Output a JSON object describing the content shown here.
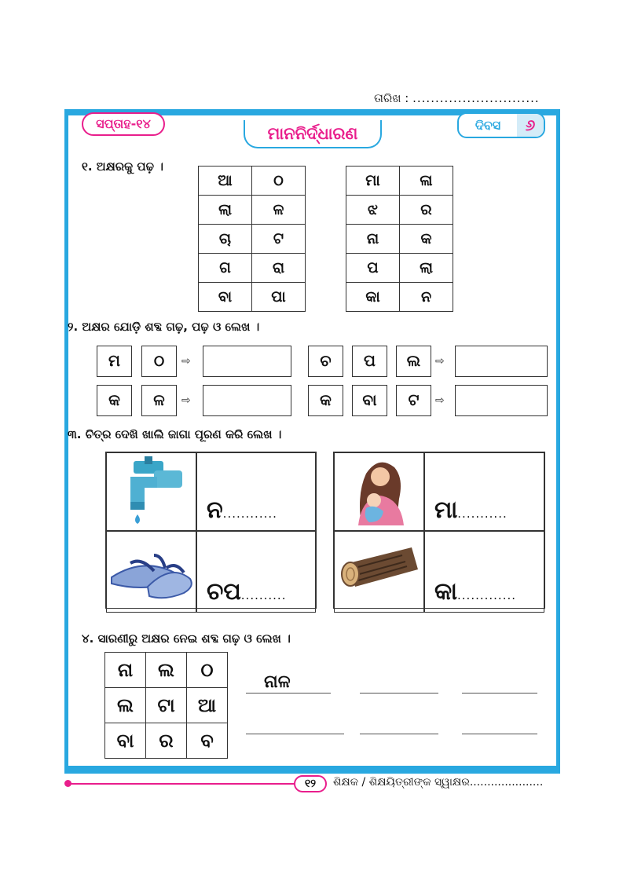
{
  "date_label": "ତାରିଖ :",
  "date_dots": "............................",
  "week_badge": "ସପ୍ତାହ-୧୪",
  "title": "ମାନନିର୍ଦ୍ଧାରଣ",
  "day_label": "ଦିବସ",
  "day_number": "୬",
  "q1": {
    "text": "୧. ଅକ୍ଷରକୁ ପଢ଼ ।",
    "table_left": [
      [
        "ଆ",
        "ଠ"
      ],
      [
        "ଲା",
        "ଳ"
      ],
      [
        "ଚା",
        "ଟ"
      ],
      [
        "ଗ",
        "ରା"
      ],
      [
        "ବା",
        "ପା"
      ]
    ],
    "table_right": [
      [
        "ମା",
        "ଳା"
      ],
      [
        "ଝ",
        "ର"
      ],
      [
        "ନା",
        "କ"
      ],
      [
        "ପ",
        "ଲା"
      ],
      [
        "କା",
        "ନ"
      ]
    ]
  },
  "q2": {
    "text": "୨. ଅକ୍ଷର ଯୋଡ଼ି ଶବ୍ଦ ଗଢ଼, ପଢ଼ ଓ ଲେଖ ।",
    "row1_left": [
      "ମ",
      "ଠ"
    ],
    "row1_right": [
      "ଚ",
      "ପ",
      "ଲ"
    ],
    "row2_left": [
      "କ",
      "ଳ"
    ],
    "row2_right": [
      "କ",
      "ବା",
      "ଟ"
    ],
    "arrow": "⇨"
  },
  "q3": {
    "text": "୩. ଚିତ୍ର ଦେଖି ଖାଲି ଜାଗା ପୂରଣ କରି ଲେଖ ।",
    "items": [
      {
        "picture": "tap-icon",
        "word": "ନ",
        "dots": "............"
      },
      {
        "picture": "slipper-icon",
        "word": "ଚପ",
        "dots": ".........."
      },
      {
        "picture": "mother-child-icon",
        "word": "ମା",
        "dots": "..........."
      },
      {
        "picture": "log-icon",
        "word": "କା",
        "dots": "............."
      }
    ]
  },
  "q4": {
    "text": "୪. ସାରଣୀରୁ ଅକ୍ଷର ନେଇ ଶବ୍ଦ ଗଢ଼ ଓ ଲେଖ ।",
    "grid": [
      [
        "ନା",
        "ଲ",
        "ଠ"
      ],
      [
        "ଲ",
        "ଟା",
        "ଆ"
      ],
      [
        "ବା",
        "ର",
        "ବ"
      ]
    ],
    "sample_word": "ନାଳ"
  },
  "footer": {
    "page_number": "୧୨",
    "sign_text": "ଶିକ୍ଷକ / ଶିକ୍ଷୟିତ୍ରୀଙ୍କ ସ୍ୱାକ୍ଷର....................."
  },
  "colors": {
    "accent_blue": "#29a8e0",
    "accent_pink": "#e91e8c"
  }
}
